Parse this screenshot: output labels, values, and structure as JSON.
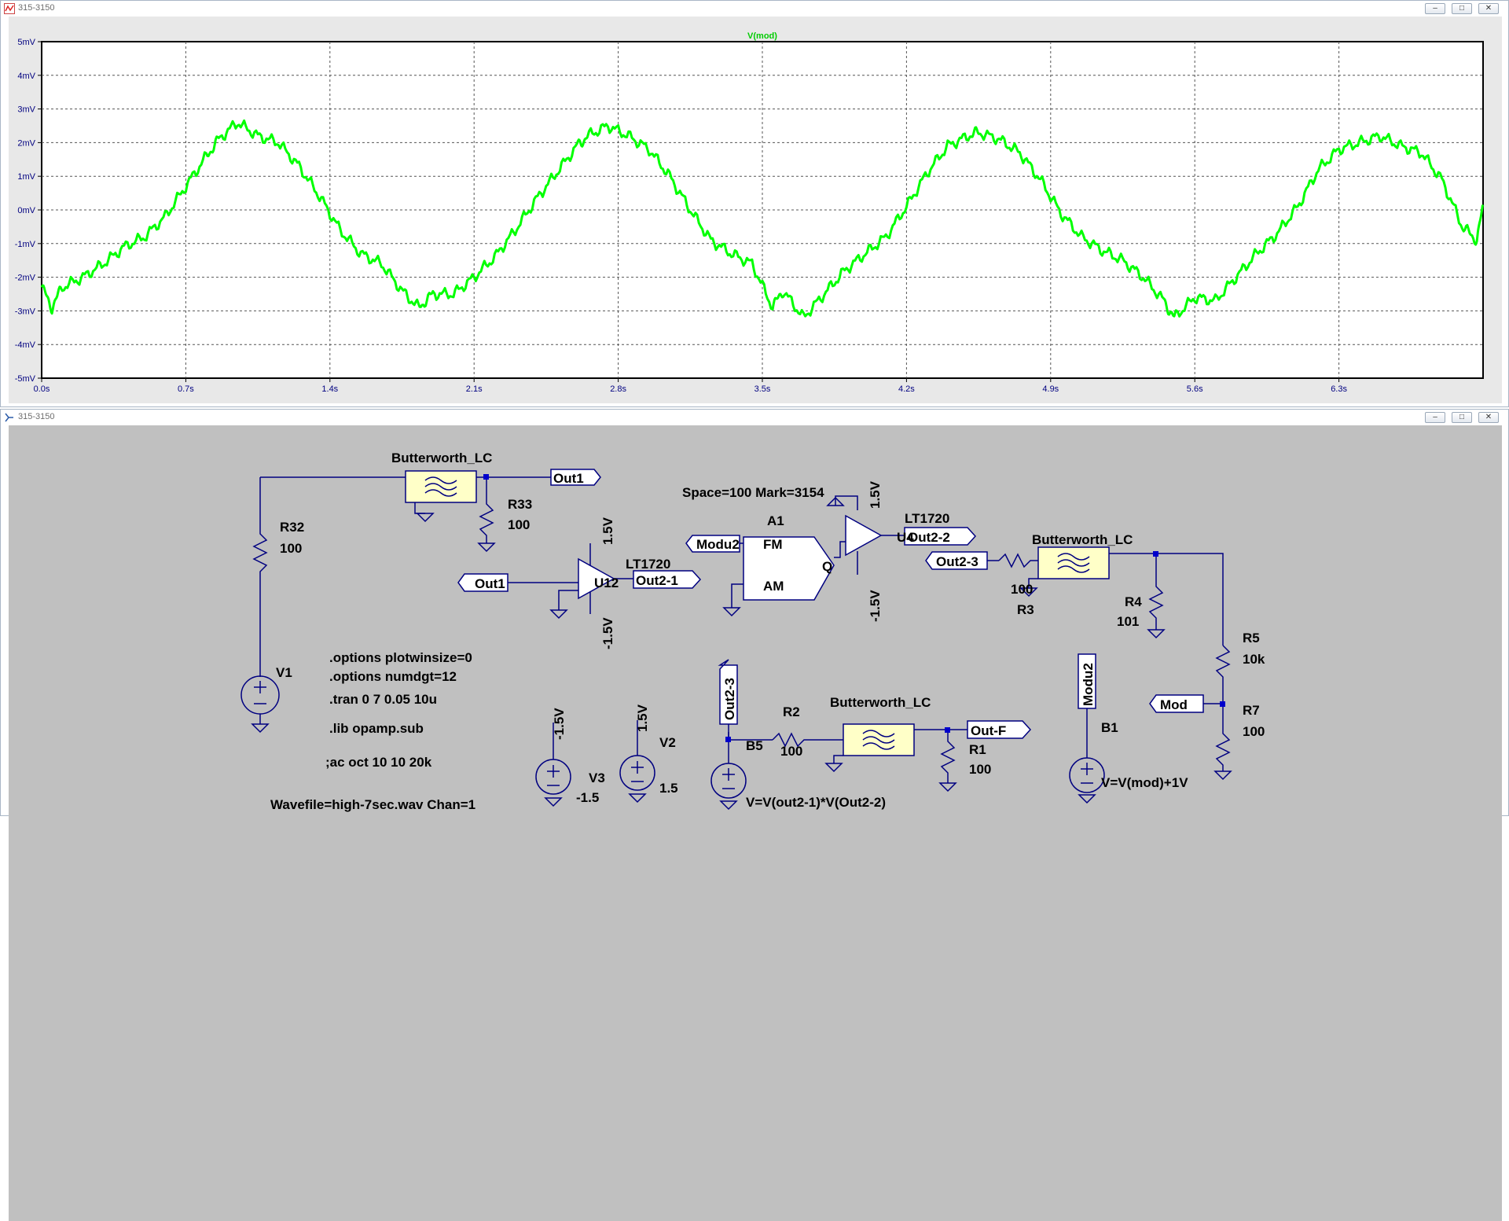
{
  "plot_window": {
    "title": "315-3150",
    "buttons": [
      "minimize",
      "maximize",
      "close"
    ]
  },
  "schematic_window": {
    "title": "315-3150",
    "buttons": [
      "minimize",
      "maximize",
      "close"
    ]
  },
  "chart_data": {
    "type": "line",
    "title": "V(mod)",
    "xlabel": "",
    "ylabel": "",
    "xlim": [
      0,
      7
    ],
    "ylim": [
      -5,
      5
    ],
    "x_ticks": [
      "0.0s",
      "0.7s",
      "1.4s",
      "2.1s",
      "2.8s",
      "3.5s",
      "4.2s",
      "4.9s",
      "5.6s",
      "6.3s"
    ],
    "y_ticks": [
      "5mV",
      "4mV",
      "3mV",
      "2mV",
      "1mV",
      "0mV",
      "-1mV",
      "-2mV",
      "-3mV",
      "-4mV",
      "-5mV"
    ],
    "grid": true,
    "series": [
      {
        "name": "V(mod)",
        "color": "#00ff00",
        "x": [
          0.0,
          0.05,
          0.1,
          0.2,
          0.3,
          0.4,
          0.5,
          0.6,
          0.7,
          0.8,
          0.86,
          0.95,
          1.05,
          1.15,
          1.25,
          1.35,
          1.45,
          1.55,
          1.65,
          1.75,
          1.83,
          1.9,
          2.0,
          2.1,
          2.2,
          2.3,
          2.4,
          2.5,
          2.6,
          2.65,
          2.75,
          2.85,
          2.95,
          3.05,
          3.15,
          3.25,
          3.35,
          3.45,
          3.55,
          3.6,
          3.7,
          3.8,
          3.9,
          4.0,
          4.1,
          4.2,
          4.3,
          4.4,
          4.5,
          4.55,
          4.65,
          4.75,
          4.85,
          4.95,
          5.05,
          5.15,
          5.25,
          5.35,
          5.45,
          5.5,
          5.6,
          5.7,
          5.8,
          5.9,
          6.0,
          6.1,
          6.2,
          6.3,
          6.4,
          6.5,
          6.6,
          6.7,
          6.8,
          6.9,
          6.97,
          7.0
        ],
        "y": [
          -2.3,
          -2.9,
          -2.3,
          -2.0,
          -1.6,
          -1.1,
          -0.8,
          -0.2,
          0.7,
          1.6,
          2.1,
          2.6,
          2.2,
          2.0,
          1.3,
          0.4,
          -0.6,
          -1.3,
          -1.6,
          -2.4,
          -2.9,
          -2.5,
          -2.5,
          -2.0,
          -1.4,
          -0.6,
          0.3,
          1.1,
          1.9,
          2.2,
          2.5,
          2.2,
          1.8,
          1.0,
          0.0,
          -0.9,
          -1.3,
          -1.6,
          -2.9,
          -2.4,
          -3.2,
          -2.5,
          -1.8,
          -1.3,
          -0.8,
          0.1,
          1.1,
          1.9,
          2.2,
          2.3,
          2.1,
          1.7,
          0.9,
          -0.1,
          -0.8,
          -1.2,
          -1.5,
          -2.0,
          -2.7,
          -3.2,
          -2.6,
          -2.7,
          -2.0,
          -1.3,
          -0.7,
          0.1,
          1.2,
          1.8,
          2.0,
          2.2,
          1.9,
          1.7,
          0.9,
          -0.5,
          -0.9,
          0.1
        ]
      }
    ]
  },
  "schematic": {
    "labels": {
      "butterworth1": "Butterworth_LC",
      "butterworth2": "Butterworth_LC",
      "butterworth3": "Butterworth_LC",
      "r32_name": "R32",
      "r32_val": "100",
      "r33_name": "R33",
      "r33_val": "100",
      "v1_name": "V1",
      "u12_model": "LT1720",
      "u12_name": "U12",
      "u12_vp": "1.5V",
      "u12_vn": "-1.5V",
      "u4_model": "LT1720",
      "u4_name": "U4",
      "u4_vp": "1.5V",
      "u4_vn": "-1.5V",
      "modulator_params": "Space=100 Mark=3154",
      "a1_name": "A1",
      "a1_fm": "FM",
      "a1_am": "AM",
      "a1_q": "Q",
      "r3_name": "R3",
      "r3_val": "100",
      "r4_name": "R4",
      "r4_val": "101",
      "r5_name": "R5",
      "r5_val": "10k",
      "r7_name": "R7",
      "r7_val": "100",
      "r2_name": "R2",
      "r2_val": "100",
      "r1_name": "R1",
      "r1_val": "100",
      "v3_name": "V3",
      "v3_top": "-1.5V",
      "v3_val": "-1.5",
      "v2_name": "V2",
      "v2_top": "1.5V",
      "v2_val": "1.5",
      "b5_name": "B5",
      "b5_expr": "V=V(out2-1)*V(Out2-2)",
      "b1_name": "B1",
      "b1_expr": "V=V(mod)+1V",
      "directive1": ".options plotwinsize=0",
      "directive2": ".options numdgt=12",
      "directive3": ".tran 0 7 0.05 10u",
      "directive4": ".lib opamp.sub",
      "directive5": ";ac oct 10 10 20k",
      "wavefile": "Wavefile=high-7sec.wav Chan=1"
    },
    "netlabels": {
      "out1_a": "Out1",
      "out1_b": "Out1",
      "out2_1": "Out2-1",
      "modu2_a": "Modu2",
      "out2_2": "Out2-2",
      "out2_3_a": "Out2-3",
      "out2_3_b": "Out2-3",
      "mod": "Mod",
      "modu2_b": "Modu2",
      "out_f": "Out-F"
    }
  }
}
